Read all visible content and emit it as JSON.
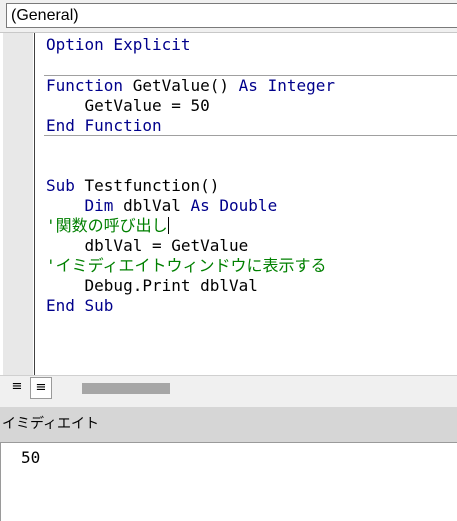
{
  "proc_dropdown": {
    "value": "(General)"
  },
  "code": {
    "l1_kw": "Option Explicit",
    "l3_kw1": "Function ",
    "l3_id": "GetValue() ",
    "l3_kw2": "As Integer",
    "l4_id": "    GetValue = 50",
    "l5_kw": "End Function",
    "l8_kw": "Sub ",
    "l8_id": "Testfunction()",
    "l9_kw1": "    Dim ",
    "l9_id": "dblVal ",
    "l9_kw2": "As Double",
    "l10_cm": "'関数の呼び出し",
    "l11_id": "    dblVal = GetValue",
    "l12_cm": "'イミディエイトウィンドウに表示する",
    "l13_id": "    Debug.Print dblVal",
    "l14_kw": "End Sub"
  },
  "colors": {
    "keyword": "#00008b",
    "comment": "#008000",
    "identifier": "#000000"
  },
  "footer": {
    "proc_view_icon": "procedure-view-icon",
    "full_view_icon": "full-module-view-icon"
  },
  "immediate": {
    "title": "イミディエイト",
    "output": "50"
  }
}
